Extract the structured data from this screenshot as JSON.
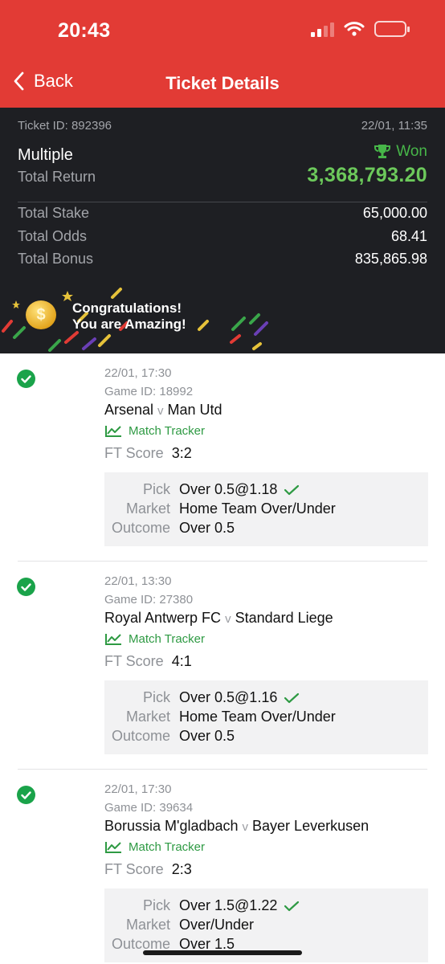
{
  "status_bar": {
    "time": "20:43"
  },
  "nav": {
    "back_label": "Back",
    "title": "Ticket Details"
  },
  "summary": {
    "ticket_id": "Ticket ID: 892396",
    "datetime": "22/01, 11:35",
    "bet_type": "Multiple",
    "status": "Won",
    "total_return_label": "Total Return",
    "total_return": "3,368,793.20",
    "rows": [
      {
        "label": "Total Stake",
        "value": "65,000.00"
      },
      {
        "label": "Total Odds",
        "value": "68.41"
      },
      {
        "label": "Total Bonus",
        "value": "835,865.98"
      }
    ],
    "congrats_line1": "Congratulations!",
    "congrats_line2": "You are Amazing!",
    "coin_symbol": "$"
  },
  "labels": {
    "match_tracker": "Match Tracker",
    "ft_score": "FT Score",
    "pick": "Pick",
    "market": "Market",
    "outcome": "Outcome",
    "vs": "v"
  },
  "bets": [
    {
      "datetime": "22/01, 17:30",
      "game_id": "Game ID: 18992",
      "home": "Arsenal",
      "away": "Man Utd",
      "ft_score": "3:2",
      "pick": "Over 0.5@1.18",
      "market": "Home Team Over/Under",
      "outcome": "Over 0.5"
    },
    {
      "datetime": "22/01, 13:30",
      "game_id": "Game ID: 27380",
      "home": "Royal Antwerp FC",
      "away": "Standard Liege",
      "ft_score": "4:1",
      "pick": "Over 0.5@1.16",
      "market": "Home Team Over/Under",
      "outcome": "Over 0.5"
    },
    {
      "datetime": "22/01, 17:30",
      "game_id": "Game ID: 39634",
      "home": "Borussia M'gladbach",
      "away": "Bayer Leverkusen",
      "ft_score": "2:3",
      "pick": "Over 1.5@1.22",
      "market": "Over/Under",
      "outcome": "Over 1.5"
    }
  ],
  "colors": {
    "header_red": "#e23b35",
    "summary_bg": "#1e1f23",
    "won_green": "#47b649",
    "check_green": "#1aa34a"
  },
  "icons": {
    "back": "chevron-left-icon",
    "won": "trophy-icon",
    "tracker": "line-chart-icon",
    "settled": "check-circle-icon",
    "pick_ok": "checkmark-icon"
  }
}
